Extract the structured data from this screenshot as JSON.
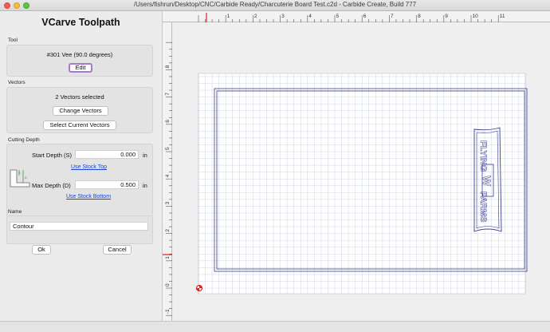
{
  "window": {
    "title": "/Users/fishrun/Desktop/CNC/Carbide Ready/Charcuterie Board Test.c2d - Carbide Create, Build 777"
  },
  "panel": {
    "title": "VCarve Toolpath",
    "tool": {
      "section_label": "Tool",
      "name": "#301 Vee (90.0 degrees)",
      "edit_label": "Edit"
    },
    "vectors": {
      "section_label": "Vectors",
      "status": "2 Vectors selected",
      "change_label": "Change Vectors",
      "select_current_label": "Select Current Vectors"
    },
    "cutting_depth": {
      "section_label": "Cutting Depth",
      "start_label": "Start Depth (S)",
      "start_value": "0.000",
      "start_unit": "in",
      "use_stock_top": "Use Stock Top",
      "max_label": "Max Depth (D)",
      "max_value": "0.500",
      "max_unit": "in",
      "use_stock_bottom": "Use Stock Bottom",
      "icon": "depth-diagram-icon",
      "icon_labels": [
        "S",
        "D"
      ]
    },
    "name": {
      "section_label": "Name",
      "value": "Contour"
    },
    "ok_label": "Ok",
    "cancel_label": "Cancel"
  },
  "canvas": {
    "x_ticks": [
      "1",
      "2",
      "3",
      "4",
      "5",
      "6",
      "7",
      "8",
      "9",
      "10",
      "11"
    ],
    "y_ticks": [
      "8",
      "7",
      "6",
      "5",
      "4",
      "3",
      "2",
      "1",
      "0",
      "-1"
    ],
    "logo_text": [
      "FLYING",
      "W",
      "FARMS"
    ],
    "colors": {
      "grid": "#cfd6e6",
      "vector": "#3b3f8f",
      "origin": "#e02020",
      "background": "#ffffff"
    }
  }
}
